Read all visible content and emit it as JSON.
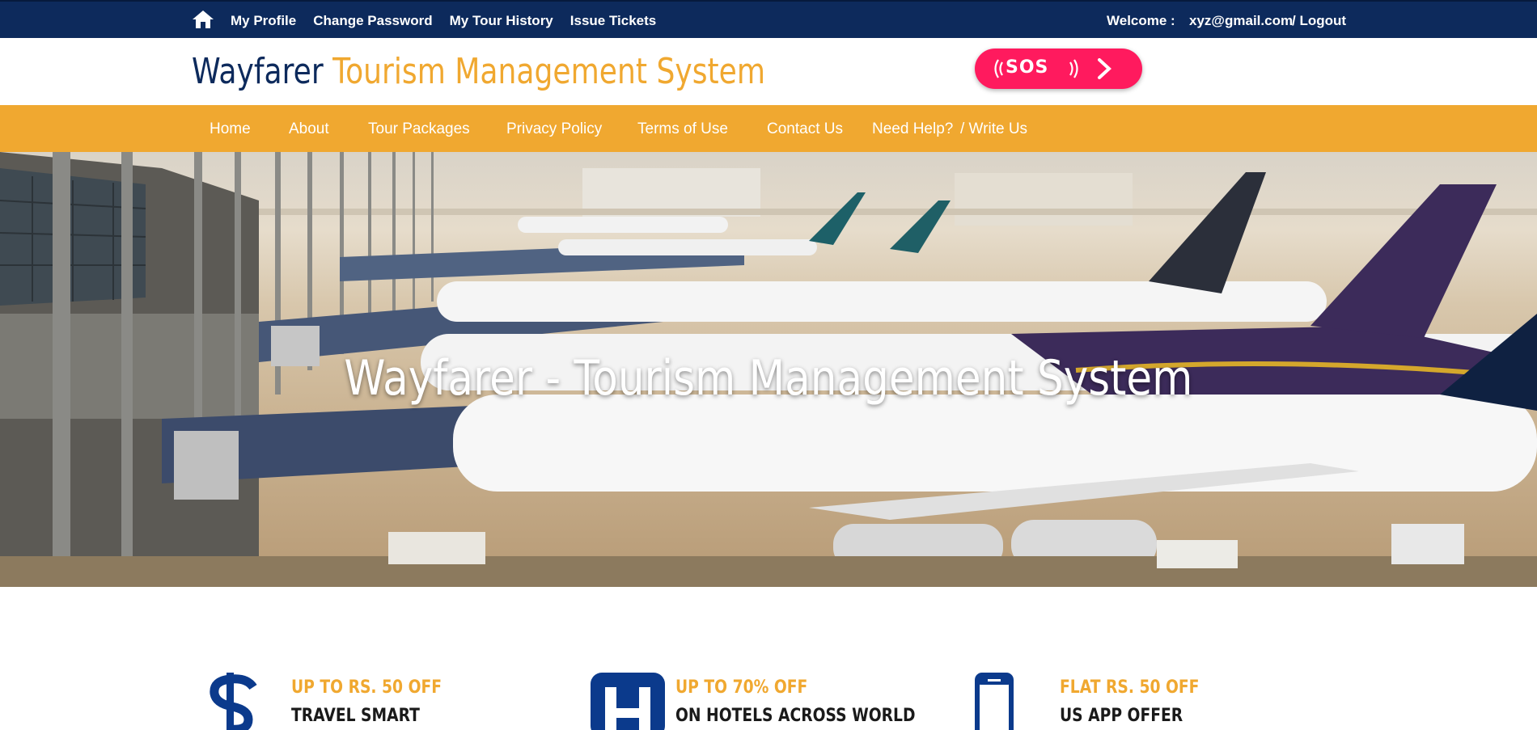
{
  "topbar": {
    "links": [
      "My Profile",
      "Change Password",
      "My Tour History",
      "Issue Tickets"
    ],
    "welcome_label": "Welcome :",
    "email": "xyz@gmail.com",
    "logout_label": "/ Logout"
  },
  "brand": {
    "name_part1": "Wayfarer ",
    "name_part2": "Tourism Management System"
  },
  "sos": {
    "label": "SOS"
  },
  "nav": {
    "items": [
      "Home",
      "About",
      "Tour Packages",
      "Privacy Policy",
      "Terms of Use",
      "Contact Us",
      "Need Help?",
      "/ Write Us"
    ]
  },
  "hero": {
    "title": "Wayfarer - Tourism Management System"
  },
  "offers": [
    {
      "title": "UP TO RS. 50 OFF",
      "subtitle": "TRAVEL SMART",
      "icon": "dollar-icon"
    },
    {
      "title": "UP TO 70% OFF",
      "subtitle": "ON HOTELS ACROSS WORLD",
      "icon": "hotel-icon"
    },
    {
      "title": "FLAT RS. 50 OFF",
      "subtitle": "US APP OFFER",
      "icon": "mobile-icon"
    }
  ],
  "colors": {
    "navy": "#0d2a5c",
    "accent": "#f0a830",
    "sos": "#ff1a5e"
  }
}
